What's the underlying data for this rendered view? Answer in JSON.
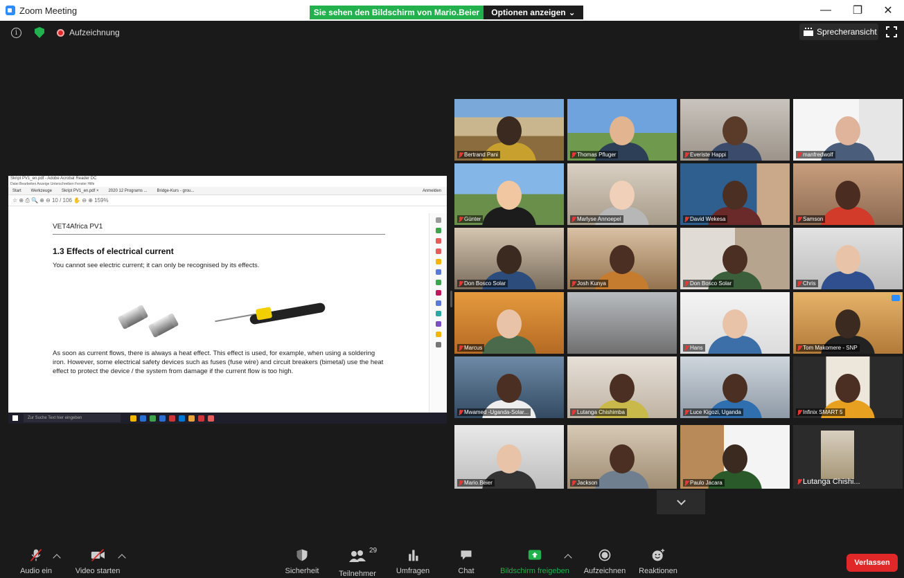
{
  "window": {
    "title": "Zoom Meeting",
    "share_banner": "Sie sehen den Bildschirm von Mario.Beier",
    "options_label": "Optionen anzeigen",
    "minimize": "—",
    "maximize": "❐",
    "close": "✕"
  },
  "topbar": {
    "recording_label": "Aufzeichnung",
    "view_label": "Sprecheransicht",
    "info_glyph": "i"
  },
  "shared_screen": {
    "acrobat_title": "Skript PV1_en.pdf - Adobe Acrobat Reader DC",
    "menu": "Datei  Bearbeiten  Anzeige  Unterschreiben  Fenster  Hilfe",
    "tabs": [
      "Start",
      "Werkzeuge",
      "Skript PV1_en.pdf ×",
      "2020 12 Programs ...",
      "Bridge-Kurs - grou..."
    ],
    "signin": "Anmelden",
    "tools": "☆  ⊕  ⎙  🔍       ⊕  ⊖   10 / 106     ✋  ⊖  ⊕  159%",
    "doc_header": "VET4Africa PV1",
    "heading": "1.3 Effects of electrical current",
    "para1": "You cannot see electric current; it can only be recognised by its effects.",
    "para2": "As soon as current flows, there is always a heat effect. This effect is used, for example, when using a soldering iron. However, some electrical safety devices such as fuses (fuse wire) and circuit breakers (bimetal) use the heat effect to protect the device / the system from damage if the current flow is too high.",
    "taskbar_search": "Zur Suche Text hier eingeben"
  },
  "participants": [
    {
      "name": "Bertrand Pani"
    },
    {
      "name": "Thomas Pfluger"
    },
    {
      "name": "Everiste Happi"
    },
    {
      "name": "manfredwolf"
    },
    {
      "name": "Günter"
    },
    {
      "name": "Marlyse Annoepel"
    },
    {
      "name": "David Wekesa"
    },
    {
      "name": "Samson"
    },
    {
      "name": "Don Bosco Solar"
    },
    {
      "name": "Josh Kunya"
    },
    {
      "name": "Don Bosco Solar"
    },
    {
      "name": "Chris"
    },
    {
      "name": "Marcus"
    },
    {
      "name": ""
    },
    {
      "name": "Hans"
    },
    {
      "name": "Tom Makomere - SNP"
    },
    {
      "name": "Mwamed -Uganda-Solar..."
    },
    {
      "name": "Lutanga Chishimba"
    },
    {
      "name": "Luce Kigozi, Uganda"
    },
    {
      "name": "Infinix SMART 5"
    },
    {
      "name": "Mario.Beier"
    },
    {
      "name": "Jackson"
    },
    {
      "name": "Paulo Jacara"
    },
    {
      "name": "Lutanga Chishi..."
    }
  ],
  "toolbar": {
    "audio": "Audio ein",
    "video": "Video starten",
    "security": "Sicherheit",
    "participants": "Teilnehmer",
    "participants_count": "29",
    "polls": "Umfragen",
    "chat": "Chat",
    "share": "Bildschirm freigeben",
    "record": "Aufzeichnen",
    "reactions": "Reaktionen",
    "leave": "Verlassen"
  },
  "colors": {
    "zoom_blue": "#2D8CFF",
    "share_green": "#22b14c",
    "leave_red": "#e02828",
    "active_speaker": "#c9df4a"
  }
}
